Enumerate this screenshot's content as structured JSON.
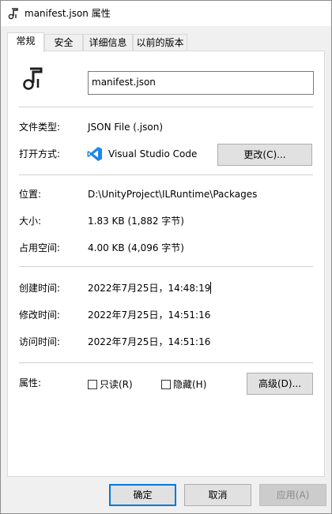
{
  "window": {
    "title": "manifest.json 属性"
  },
  "tabs": [
    {
      "label": "常规"
    },
    {
      "label": "安全"
    },
    {
      "label": "详细信息"
    },
    {
      "label": "以前的版本"
    }
  ],
  "file": {
    "name": "manifest.json"
  },
  "type": {
    "label": "文件类型:",
    "value": "JSON File (.json)"
  },
  "open_with": {
    "label": "打开方式:",
    "app": "Visual Studio Code",
    "change_button": "更改(C)..."
  },
  "location": {
    "label": "位置:",
    "value": "D:\\UnityProject\\ILRuntime\\Packages"
  },
  "size": {
    "label": "大小:",
    "value": "1.83 KB (1,882 字节)"
  },
  "size_on_disk": {
    "label": "占用空间:",
    "value": "4.00 KB (4,096 字节)"
  },
  "created": {
    "label": "创建时间:",
    "value": "2022年7月25日，14:48:19"
  },
  "modified": {
    "label": "修改时间:",
    "value": "2022年7月25日，14:51:16"
  },
  "accessed": {
    "label": "访问时间:",
    "value": "2022年7月25日，14:51:16"
  },
  "attributes": {
    "label": "属性:",
    "readonly_label": "只读(R)",
    "readonly_checked": false,
    "hidden_label": "隐藏(H)",
    "hidden_checked": false,
    "advanced_button": "高级(D)..."
  },
  "footer": {
    "ok": "确定",
    "cancel": "取消",
    "apply": "应用(A)"
  },
  "colors": {
    "accent": "#0078d7",
    "vs_blue": "#1e88e5"
  }
}
